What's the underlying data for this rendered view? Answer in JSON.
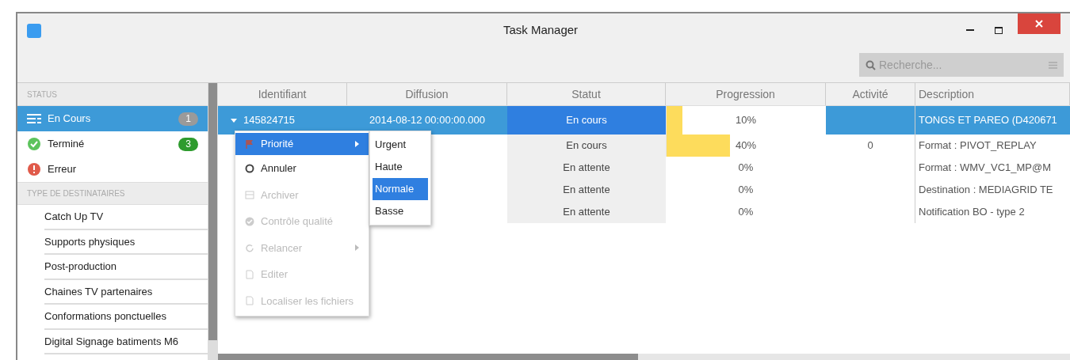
{
  "window": {
    "title": "Task Manager"
  },
  "search": {
    "placeholder": "Recherche..."
  },
  "sidebar": {
    "sections": [
      {
        "title": "STATUS",
        "items": [
          {
            "label": "En Cours",
            "kind": "running",
            "badge": "1",
            "color": "#9a9a9a",
            "selected": true
          },
          {
            "label": "Terminé",
            "kind": "done",
            "badge": "3",
            "color": "#2e9b2e",
            "selected": false
          },
          {
            "label": "Erreur",
            "kind": "error",
            "selected": false
          }
        ]
      },
      {
        "title": "TYPE DE DESTINATAIRES",
        "items": [
          {
            "label": "Catch Up TV",
            "kind": "plain",
            "selected": false
          },
          {
            "label": "Supports physiques",
            "kind": "plain",
            "selected": false
          },
          {
            "label": "Post-production",
            "kind": "plain",
            "selected": false
          },
          {
            "label": "Chaines TV partenaires",
            "kind": "plain",
            "selected": false
          },
          {
            "label": "Conformations ponctuelles",
            "kind": "plain",
            "selected": false
          },
          {
            "label": "Digital Signage batiments M6",
            "kind": "plain",
            "selected": false
          }
        ]
      }
    ]
  },
  "table": {
    "columns": [
      "Identifiant",
      "Diffusion",
      "Statut",
      "Progression",
      "Activité",
      "Description"
    ],
    "rows": [
      {
        "expanded": true,
        "id": "145824715",
        "diffusion": "2014-08-12 00:00:00.000",
        "status": "En cours",
        "level": 0.1,
        "progress": "10%",
        "activity": "",
        "description": "TONGS ET PAREO (D420671",
        "selected": true
      },
      {
        "status": "En cours",
        "level": 0.4,
        "progress": "40%",
        "activity": "0",
        "description": "Format : PIVOT_REPLAY",
        "selected": false
      },
      {
        "status": "En attente",
        "progress": "0%",
        "description": "Format : WMV_VC1_MP@M",
        "selected": false
      },
      {
        "status": "En attente",
        "progress": "0%",
        "description": "Destination : MEDIAGRID TE",
        "selected": false
      },
      {
        "status": "En attente",
        "progress": "0%",
        "description": "Notification BO - type 2",
        "selected": false
      }
    ]
  },
  "context_menu": {
    "items": [
      {
        "label": "Priorité",
        "kind": "flag",
        "disabled": false,
        "submenu": true,
        "selected": true
      },
      {
        "label": "Annuler",
        "kind": "cancel",
        "disabled": false,
        "submenu": false,
        "selected": false
      },
      {
        "label": "Archiver",
        "kind": "archive",
        "disabled": true,
        "submenu": false,
        "selected": false
      },
      {
        "label": "Contrôle qualité",
        "kind": "check",
        "disabled": true,
        "submenu": false,
        "selected": false
      },
      {
        "label": "Relancer",
        "kind": "restart",
        "disabled": true,
        "submenu": true,
        "selected": false
      },
      {
        "label": "Editer",
        "kind": "file",
        "disabled": true,
        "submenu": false,
        "selected": false
      },
      {
        "label": "Localiser les fichiers",
        "kind": "file",
        "disabled": true,
        "submenu": false,
        "selected": false
      }
    ]
  },
  "submenu": {
    "items": [
      {
        "label": "Urgent",
        "selected": false
      },
      {
        "label": "Haute",
        "selected": false
      },
      {
        "label": "Normale",
        "selected": true
      },
      {
        "label": "Basse",
        "selected": false
      }
    ]
  }
}
